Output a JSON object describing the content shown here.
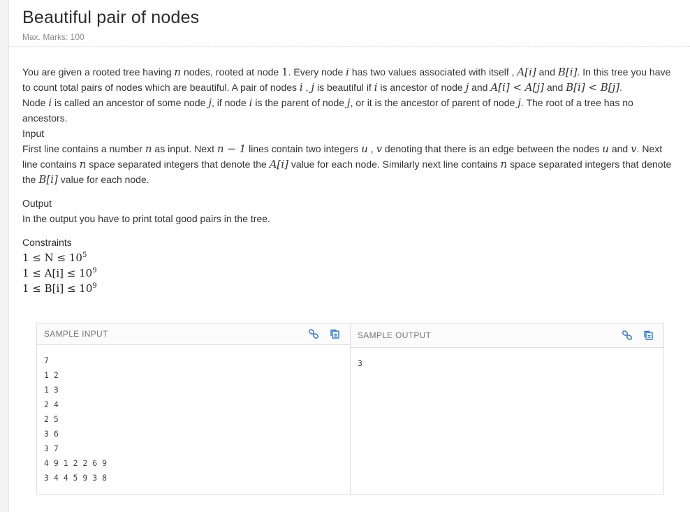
{
  "header": {
    "title": "Beautiful pair of nodes",
    "max_marks": "Max. Marks: 100"
  },
  "statement": {
    "para1_a": "You are given a rooted tree having ",
    "para1_n": "n",
    "para1_b": " nodes, rooted at node ",
    "para1_one": "1",
    "para1_c": ". Every node ",
    "para1_i": "i",
    "para1_d": " has two values associated with itself , ",
    "para1_ai": "A[i]",
    "para1_e": " and ",
    "para1_bi": "B[i]",
    "para1_f": ". In this tree you have to count total pairs of nodes which are beautiful. A pair of nodes ",
    "para1_i2": "i",
    "para1_g": " , ",
    "para1_j": "j",
    "para1_h": " is beautiful if ",
    "para1_i3": "i",
    "para1_k": " is ancestor of node ",
    "para1_j2": "j",
    "para1_l": " and ",
    "para1_cmp1": "A[i] < A[j]",
    "para1_m": " and ",
    "para1_cmp2": "B[i] < B[j]",
    "para1_end": ".",
    "para2_a": "Node ",
    "para2_i": "i",
    "para2_b": " is called an ancestor of some node ",
    "para2_j": "j",
    "para2_c": ", if node ",
    "para2_i2": "i",
    "para2_d": " is the parent of node ",
    "para2_j2": "j",
    "para2_e": ", or it is the ancestor of parent of node ",
    "para2_j3": "j",
    "para2_f": ". The root of a tree has no ancestors."
  },
  "input_section": {
    "heading": "Input",
    "t1": "First line contains a number ",
    "m1": "n",
    "t2": " as input. Next ",
    "m2": "n − 1",
    "t3": " lines contain two integers ",
    "m3": "u",
    "t4": " , ",
    "m4": "v",
    "t5": " denoting that there is an edge between the nodes ",
    "m5": "u",
    "t6": " and ",
    "m6": "v",
    "t7": ". Next line contains ",
    "m7": "n",
    "t8": " space separated integers that denote the ",
    "m8": "A[i]",
    "t9": " value for each node. Similarly next line contains ",
    "m9": "n",
    "t10": " space separated integers that denote the ",
    "m10": "B[i]",
    "t11": " value for each node."
  },
  "output_section": {
    "heading": "Output",
    "text": "In the output you have to print total good pairs in the tree."
  },
  "constraints": {
    "heading": "Constraints",
    "c1_base": "1 ≤ N ≤ 10",
    "c1_exp": "5",
    "c2_base": "1 ≤ A[i] ≤ 10",
    "c2_exp": "9",
    "c3_base": "1 ≤ B[i] ≤ 10",
    "c3_exp": "9"
  },
  "samples": {
    "input_label": "SAMPLE INPUT",
    "output_label": "SAMPLE OUTPUT",
    "input_text": "7\n1 2\n1 3\n2 4\n2 5\n3 6\n3 7\n4 9 1 2 2 6 9\n3 4 4 5 9 3 8",
    "output_text": "3",
    "icons": [
      "link-icon",
      "copy-icon"
    ],
    "icon_color": "#2f78c4"
  }
}
